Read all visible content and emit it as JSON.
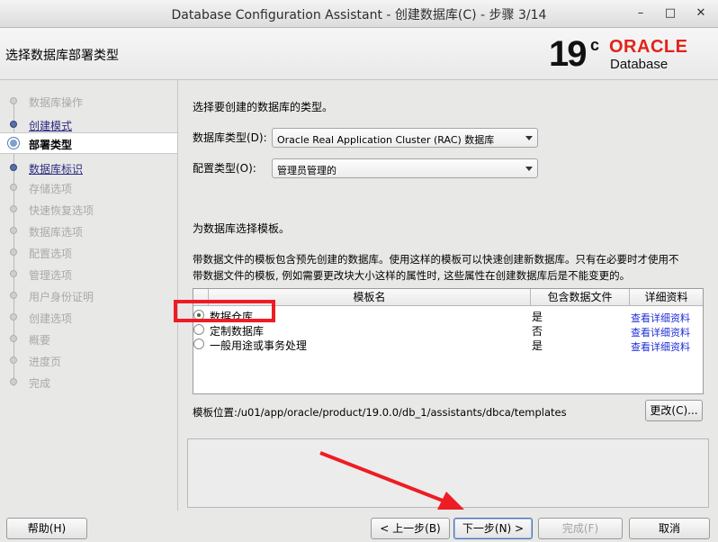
{
  "window": {
    "title": "Database Configuration Assistant - 创建数据库(C) - 步骤 3/14",
    "minimize_glyph": "–",
    "maximize_glyph": "□",
    "close_glyph": "✕"
  },
  "header": {
    "title": "选择数据库部署类型",
    "logo": {
      "version": "19",
      "superscript": "c",
      "brand": "ORACLE",
      "product": "Database"
    }
  },
  "steps": [
    {
      "label": "数据库操作",
      "state": "disabled"
    },
    {
      "label": "创建模式",
      "state": "link"
    },
    {
      "label": "部署类型",
      "state": "current"
    },
    {
      "label": "数据库标识",
      "state": "link"
    },
    {
      "label": "存储选项",
      "state": "disabled"
    },
    {
      "label": "快速恢复选项",
      "state": "disabled"
    },
    {
      "label": "数据库选项",
      "state": "disabled"
    },
    {
      "label": "配置选项",
      "state": "disabled"
    },
    {
      "label": "管理选项",
      "state": "disabled"
    },
    {
      "label": "用户身份证明",
      "state": "disabled"
    },
    {
      "label": "创建选项",
      "state": "disabled"
    },
    {
      "label": "概要",
      "state": "disabled"
    },
    {
      "label": "进度页",
      "state": "disabled"
    },
    {
      "label": "完成",
      "state": "disabled"
    }
  ],
  "form": {
    "intro": "选择要创建的数据库的类型。",
    "db_type_label": "数据库类型(D):",
    "db_type_value": "Oracle Real Application Cluster (RAC) 数据库",
    "config_type_label": "配置类型(O):",
    "config_type_value": "管理员管理的",
    "template_heading": "为数据库选择模板。",
    "template_desc_1": "带数据文件的模板包含预先创建的数据库。使用这样的模板可以快速创建新数据库。只有在必要时才使用不",
    "template_desc_2": "带数据文件的模板, 例如需要更改块大小这样的属性时, 这些属性在创建数据库后是不能变更的。"
  },
  "table": {
    "headers": {
      "name": "模板名",
      "datafiles": "包含数据文件",
      "details": "详细资料"
    },
    "rows": [
      {
        "name": "数据仓库",
        "datafiles": "是",
        "details": "查看详细资料",
        "selected": true
      },
      {
        "name": "定制数据库",
        "datafiles": "否",
        "details": "查看详细资料",
        "selected": false
      },
      {
        "name": "一般用途或事务处理",
        "datafiles": "是",
        "details": "查看详细资料",
        "selected": false
      }
    ]
  },
  "template_location": "模板位置:/u01/app/oracle/product/19.0.0/db_1/assistants/dbca/templates",
  "buttons": {
    "change": "更改(C)...",
    "help": "帮助(H)",
    "back": "< 上一步(B)",
    "next": "下一步(N) >",
    "finish": "完成(F)",
    "cancel": "取消"
  },
  "colors": {
    "annotation_red": "#ee1c24",
    "oracle_red": "#e2231a",
    "link_blue": "#1f2fd6"
  }
}
